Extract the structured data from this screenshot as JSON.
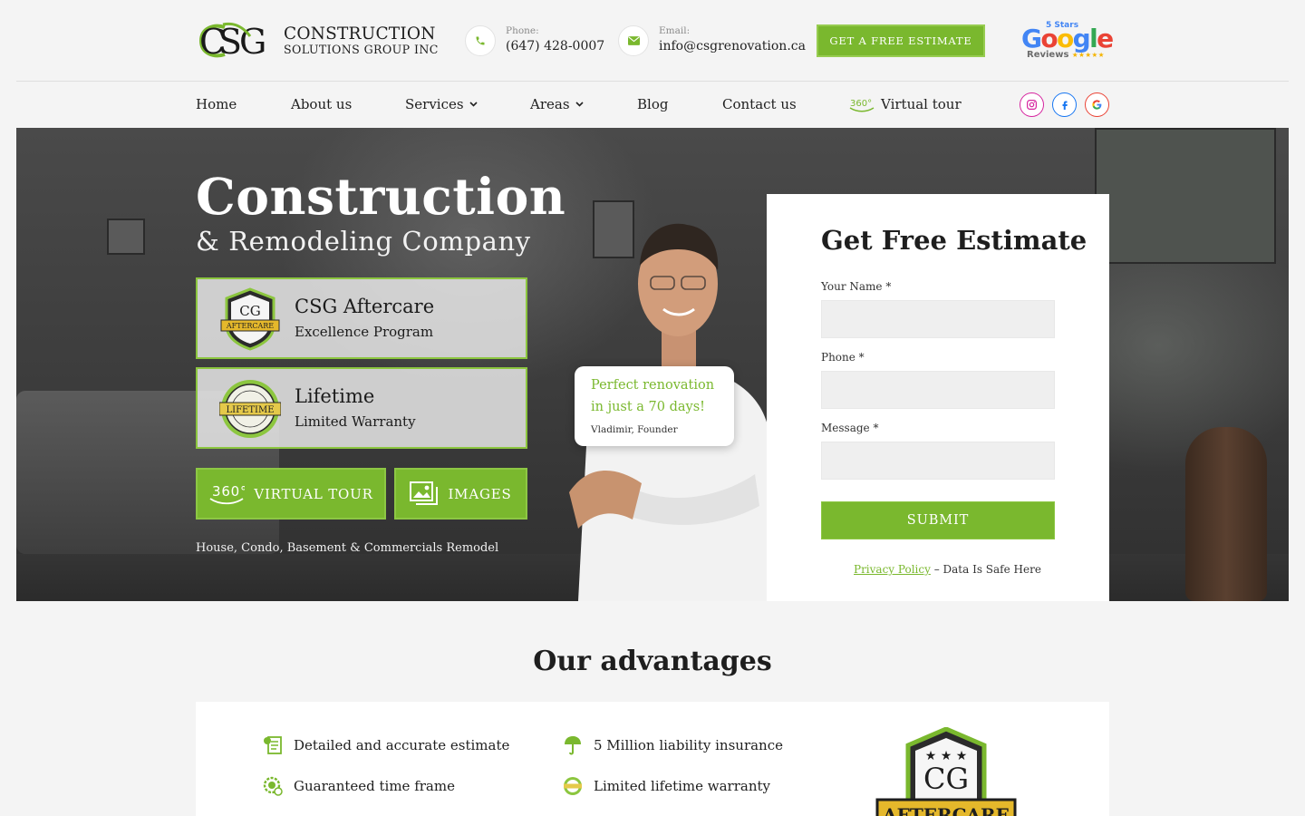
{
  "header": {
    "logo_name": "CONSTRUCTION",
    "logo_sub": "SOLUTIONS GROUP INC",
    "phone_label": "Phone:",
    "phone_value": "(647) 428-0007",
    "email_label": "Email:",
    "email_value": "info@csgrenovation.ca",
    "cta_label": "GET A FREE ESTIMATE",
    "google_stars": "5 Stars",
    "google_word": "Google",
    "google_reviews": "Reviews",
    "google_rating": "★★★★★"
  },
  "nav": {
    "items": [
      {
        "label": "Home"
      },
      {
        "label": "About us"
      },
      {
        "label": "Services"
      },
      {
        "label": "Areas"
      },
      {
        "label": "Blog"
      },
      {
        "label": "Contact us"
      },
      {
        "label": "Virtual tour"
      }
    ],
    "tour_icon_text": "360°"
  },
  "hero": {
    "title": "Construction",
    "subtitle": "& Remodeling Company",
    "aftercare_title": "CSG Aftercare",
    "aftercare_sub": "Excellence Program",
    "aftercare_badge_text": "AFTERCARE",
    "warranty_title": "Lifetime",
    "warranty_sub": "Limited Warranty",
    "warranty_badge_text": "LIFETIME",
    "tour_button": "VIRTUAL TOUR",
    "tour_icon_text": "360°",
    "images_button": "IMAGES",
    "note": "House, Condo, Basement & Commercials Remodel",
    "quote_line1": "Perfect renovation",
    "quote_line2": "in just a 70 days!",
    "quote_author": "Vladimir, Founder"
  },
  "form": {
    "title": "Get Free Estimate",
    "name_label": "Your Name *",
    "phone_label": "Phone *",
    "message_label": "Message *",
    "submit_label": "SUBMIT",
    "privacy_link": "Privacy Policy",
    "privacy_text": " – Data Is Safe Here"
  },
  "advantages": {
    "title": "Our advantages",
    "items": [
      {
        "label": "Detailed and accurate estimate"
      },
      {
        "label": "5 Million liability insurance"
      },
      {
        "label": "Guaranteed time frame"
      },
      {
        "label": "Limited lifetime warranty"
      }
    ],
    "badge_text": "AFTERCARE"
  },
  "colors": {
    "accent": "#7ab82e",
    "accent_border": "#8cc63f",
    "dark_text": "#1e1e1e"
  }
}
